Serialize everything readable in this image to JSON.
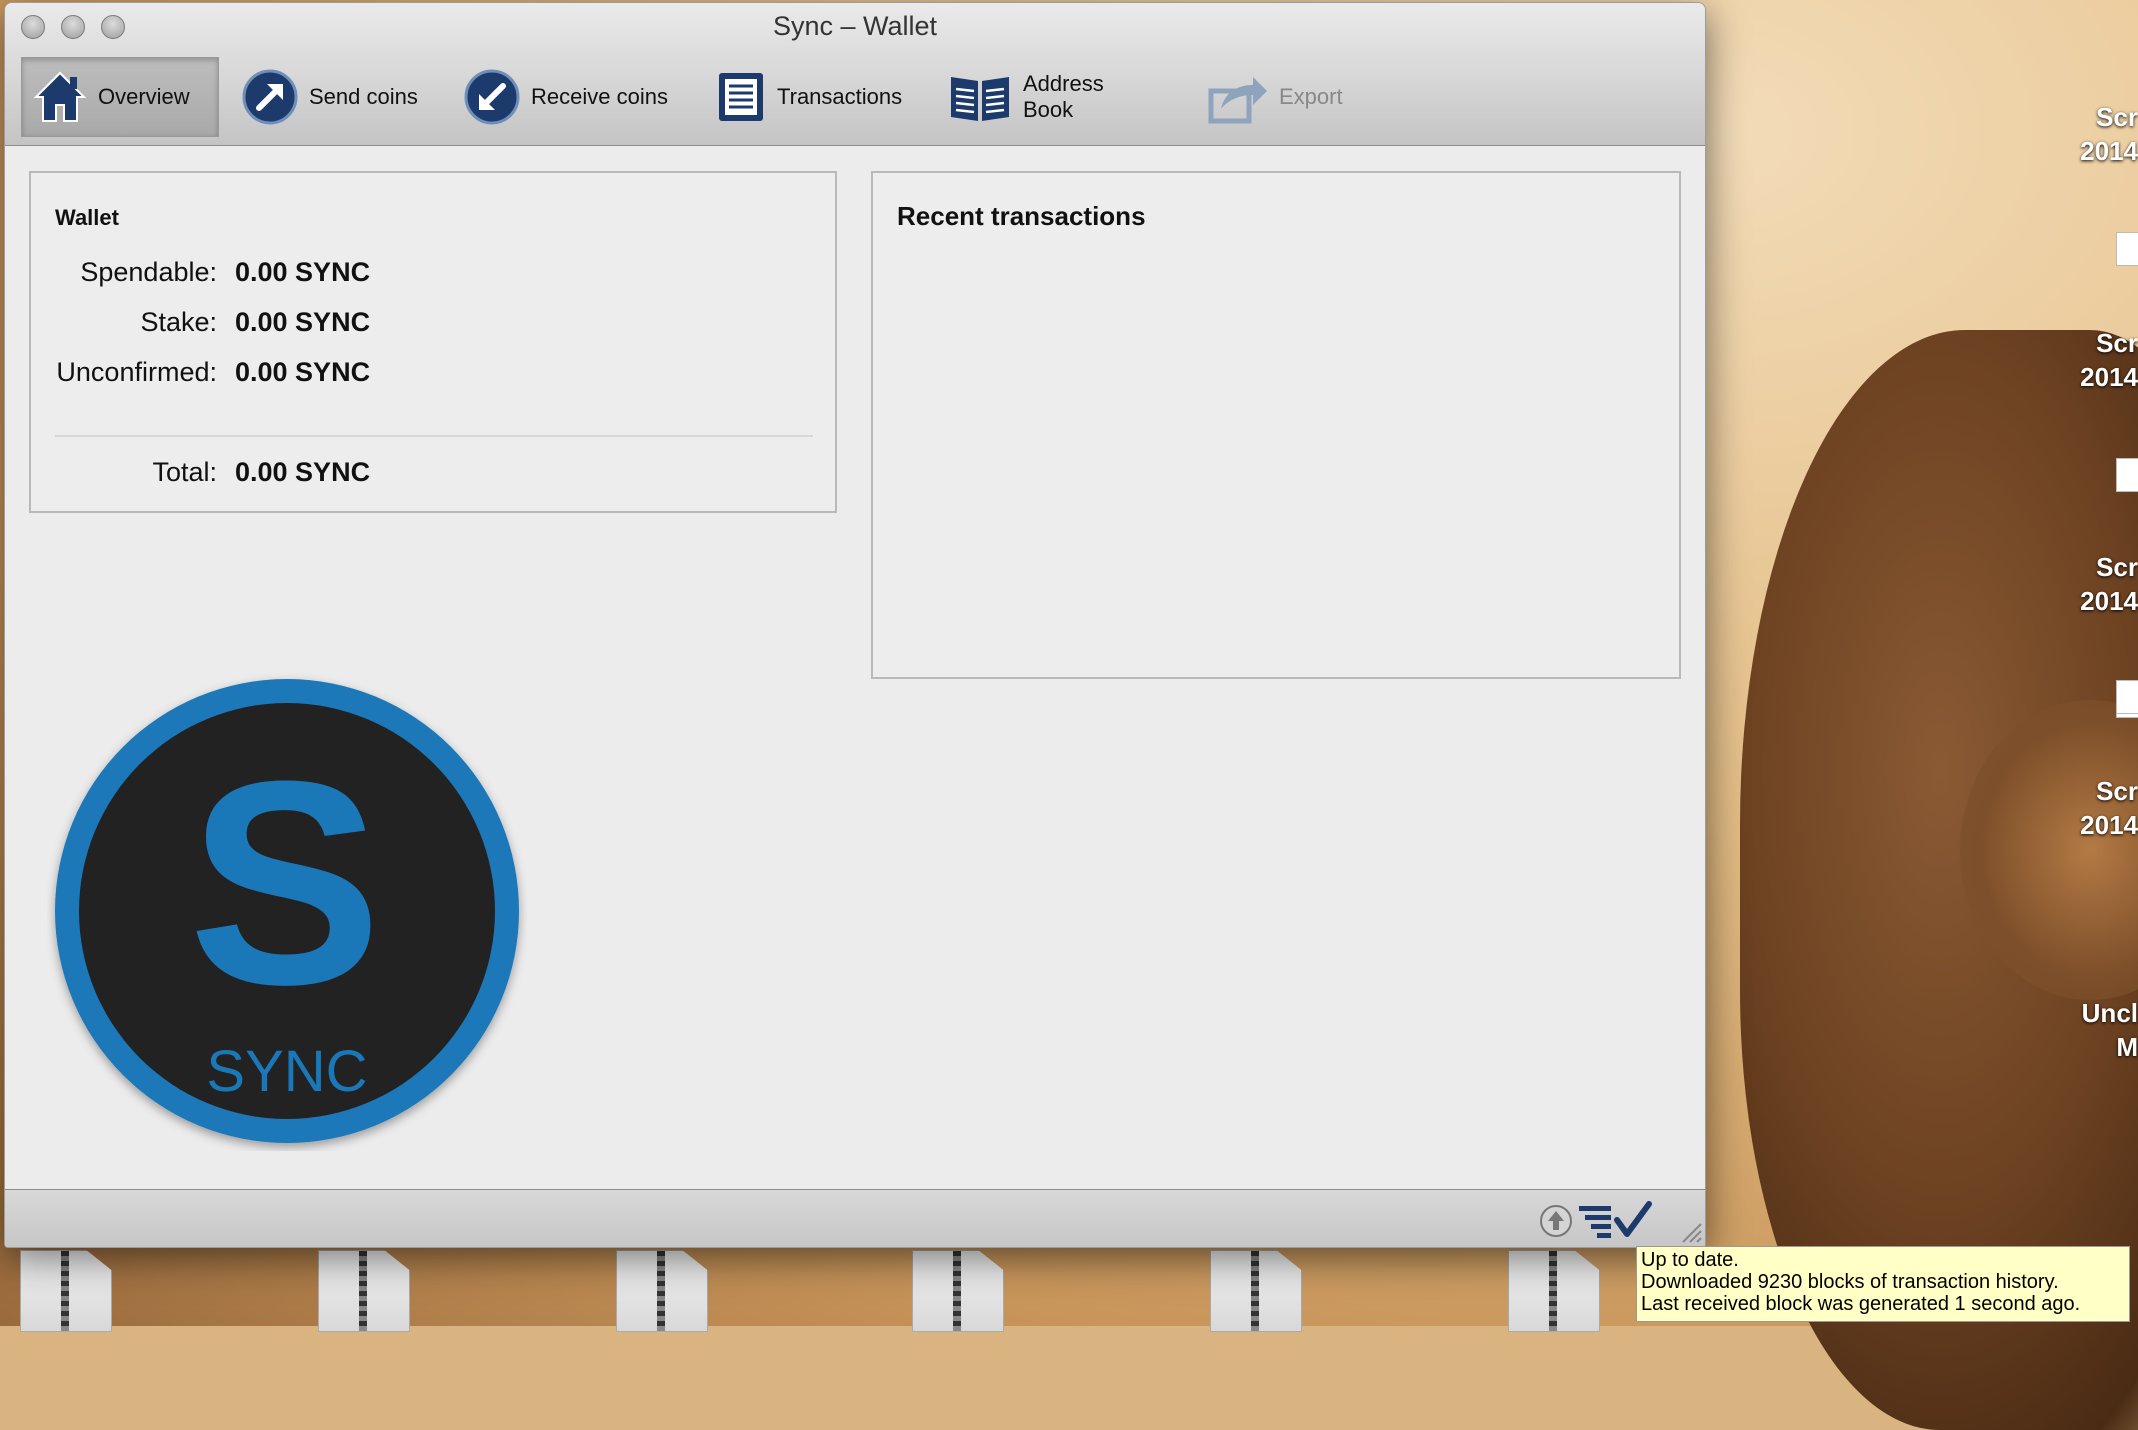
{
  "window": {
    "title": "Sync – Wallet"
  },
  "toolbar": {
    "overview": "Overview",
    "send": "Send coins",
    "receive": "Receive coins",
    "transactions": "Transactions",
    "address_book": "Address Book",
    "export": "Export"
  },
  "wallet": {
    "heading": "Wallet",
    "spendable_label": "Spendable:",
    "spendable_value": "0.00 SYNC",
    "stake_label": "Stake:",
    "stake_value": "0.00 SYNC",
    "unconfirmed_label": "Unconfirmed:",
    "unconfirmed_value": "0.00 SYNC",
    "total_label": "Total:",
    "total_value": "0.00 SYNC"
  },
  "recent": {
    "heading": "Recent transactions"
  },
  "logo": {
    "letter": "S",
    "text": "SYNC"
  },
  "tooltip": {
    "line1": "Up to date.",
    "line2": "Downloaded 9230 blocks of transaction history.",
    "line3": "Last received block was generated 1 second ago."
  },
  "desktop": {
    "labels": [
      "Scr",
      "2014",
      "Scr",
      "2014",
      "Scr",
      "2014",
      "Scr",
      "2014",
      "Uncl",
      "M"
    ]
  },
  "colors": {
    "accent_blue": "#1a78b8",
    "icon_navy": "#1c3a6b",
    "logo_dark": "#222222"
  }
}
